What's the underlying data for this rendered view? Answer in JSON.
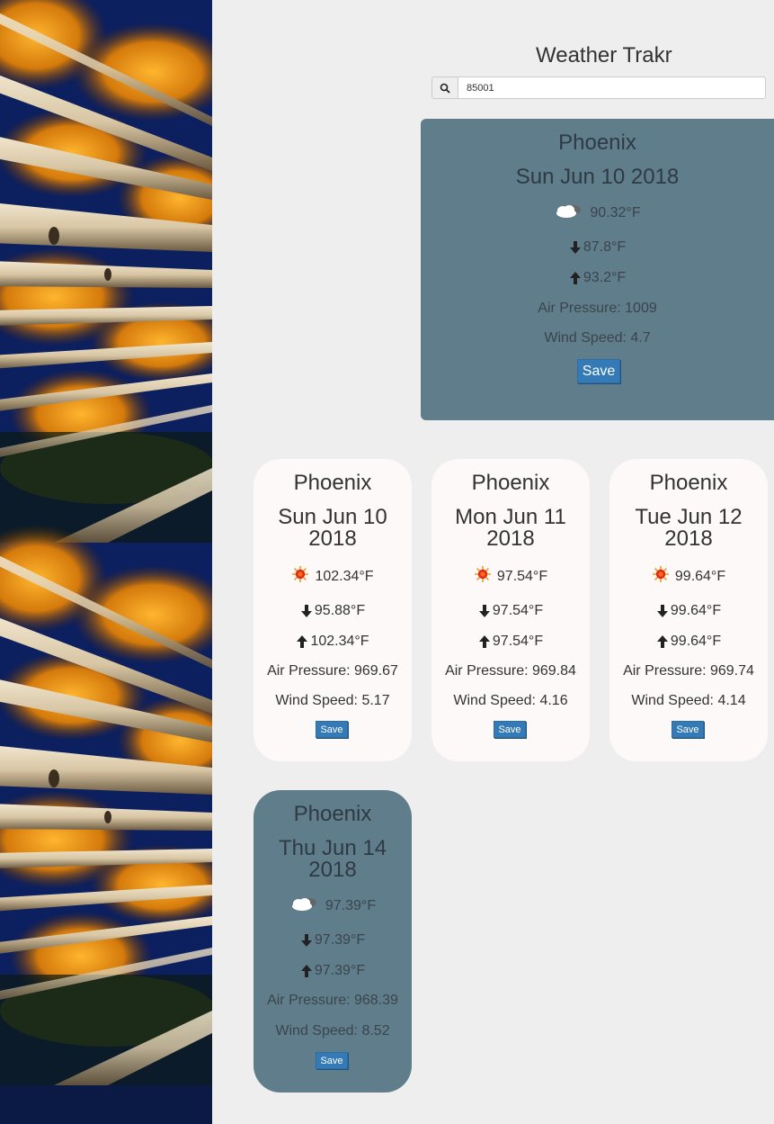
{
  "app": {
    "title": "Weather Trakr"
  },
  "search": {
    "value": "85001",
    "icon": "search-icon"
  },
  "current": {
    "city": "Phoenix",
    "date": "Sun Jun 10 2018",
    "icon": "cloudy-icon",
    "temp": "90.32°F",
    "low": "87.8°F",
    "high": "93.2°F",
    "pressure": "Air Pressure: 1009",
    "wind": "Wind Speed: 4.7",
    "save": "Save"
  },
  "forecast": [
    {
      "city": "Phoenix",
      "date1": "Sun Jun 10",
      "date2": "2018",
      "icon": "sun-icon",
      "temp": "102.34°F",
      "low": "95.88°F",
      "high": "102.34°F",
      "pressure": "Air Pressure: 969.67",
      "wind": "Wind Speed: 5.17",
      "save": "Save"
    },
    {
      "city": "Phoenix",
      "date1": "Mon Jun 11",
      "date2": "2018",
      "icon": "sun-icon",
      "temp": "97.54°F",
      "low": "97.54°F",
      "high": "97.54°F",
      "pressure": "Air Pressure: 969.84",
      "wind": "Wind Speed: 4.16",
      "save": "Save"
    },
    {
      "city": "Phoenix",
      "date1": "Tue Jun 12",
      "date2": "2018",
      "icon": "sun-icon",
      "temp": "99.64°F",
      "low": "99.64°F",
      "high": "99.64°F",
      "pressure": "Air Pressure: 969.74",
      "wind": "Wind Speed: 4.14",
      "save": "Save"
    },
    {
      "city": "Phoenix",
      "date1": "Thu Jun 14",
      "date2": "2018",
      "icon": "cloudy-icon",
      "temp": "97.39°F",
      "low": "97.39°F",
      "high": "97.39°F",
      "pressure": "Air Pressure: 968.39",
      "wind": "Wind Speed: 8.52",
      "save": "Save"
    }
  ],
  "colors": {
    "card_dark": "#607d8b",
    "card_light": "#fcf9f8",
    "button": "#337ab7",
    "page": "#eeeeee"
  }
}
